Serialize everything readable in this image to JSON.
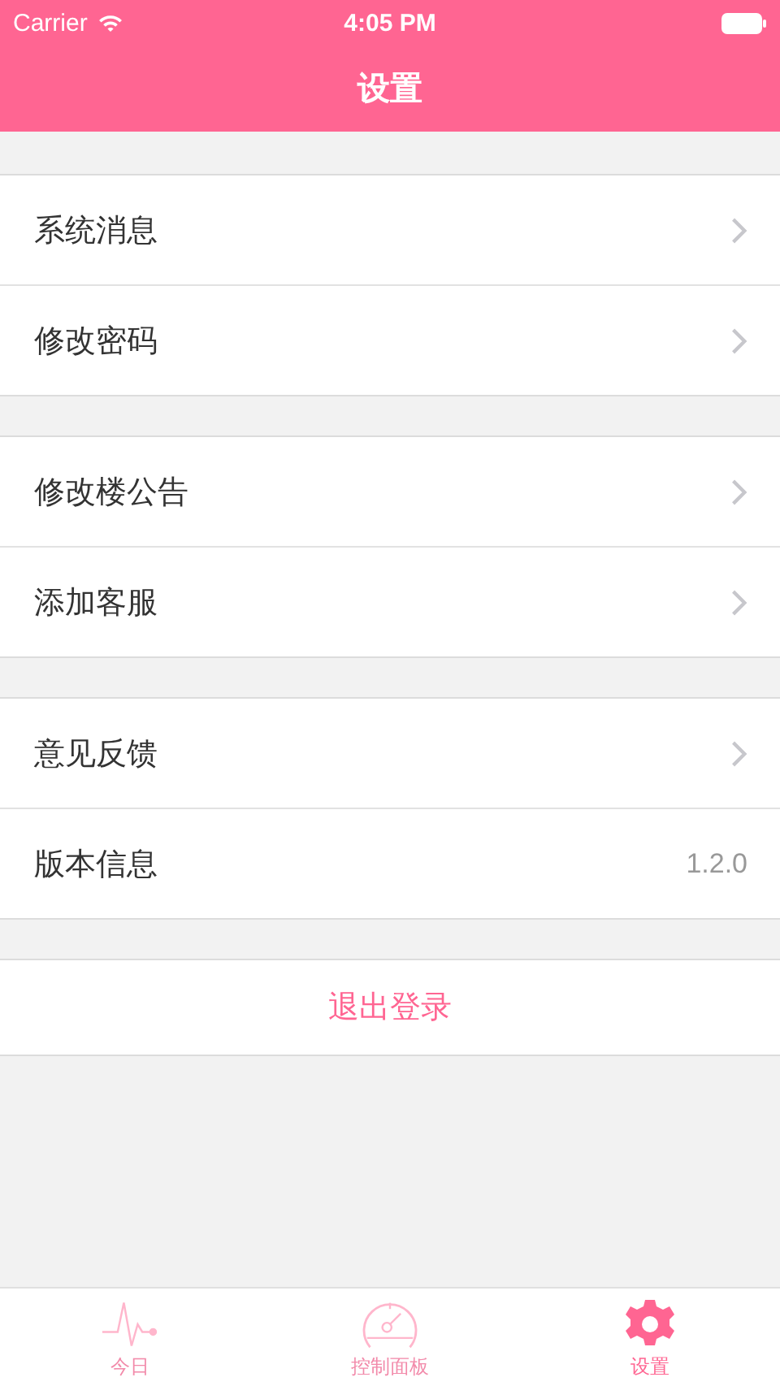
{
  "status_bar": {
    "carrier": "Carrier",
    "time": "4:05 PM"
  },
  "nav": {
    "title": "设置"
  },
  "groups": [
    {
      "rows": [
        {
          "kind": "link",
          "label": "系统消息"
        },
        {
          "kind": "link",
          "label": "修改密码"
        }
      ]
    },
    {
      "rows": [
        {
          "kind": "link",
          "label": "修改楼公告"
        },
        {
          "kind": "link",
          "label": "添加客服"
        }
      ]
    },
    {
      "rows": [
        {
          "kind": "link",
          "label": "意见反馈"
        },
        {
          "kind": "value",
          "label": "版本信息",
          "value": "1.2.0"
        }
      ]
    }
  ],
  "logout": {
    "label": "退出登录"
  },
  "tabs": [
    {
      "kind": "pulse",
      "label": "今日",
      "selected": false
    },
    {
      "kind": "gauge",
      "label": "控制面板",
      "selected": false
    },
    {
      "kind": "gear",
      "label": "设置",
      "selected": true
    }
  ]
}
